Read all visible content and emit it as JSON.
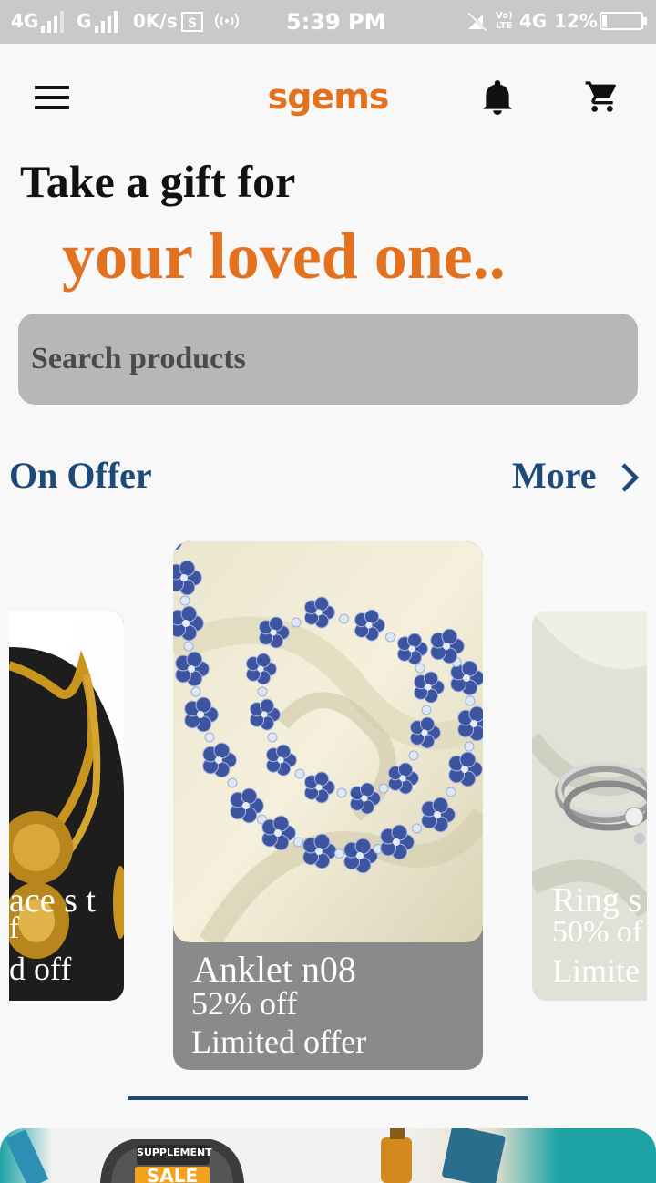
{
  "status_bar": {
    "network_1": "4G",
    "network_2": "G",
    "speed": "0K/s",
    "time": "5:39 PM",
    "volte": "Vo) LTE",
    "network_3": "4G",
    "battery": "12%"
  },
  "app_bar": {
    "logo_part1": "s",
    "logo_part2": "ge",
    "logo_part3": "ms",
    "icons": [
      "menu-icon",
      "bell-icon",
      "cart-icon"
    ]
  },
  "hero": {
    "line1": "Take a gift for",
    "line2": "your loved one.."
  },
  "search": {
    "placeholder": "Search products"
  },
  "offers": {
    "title": "On Offer",
    "more_label": "More",
    "cards": [
      {
        "name_partial": "ace s t",
        "line2_partial": "f",
        "line3_partial": "d off"
      },
      {
        "name": "Anklet n08",
        "discount": "52% off",
        "tag": "Limited offer"
      },
      {
        "name_partial": "Ring s",
        "discount_partial": "50% of",
        "tag_partial": "Limite"
      }
    ]
  },
  "banner": {
    "badge_top": "SUPPLEMENT",
    "badge_main": "SALE"
  },
  "colors": {
    "accent_orange": "#e27220",
    "navy": "#1d4a78",
    "status_bar": "#c9c9c9",
    "search_bg": "#b7b7b7",
    "caption_bg": "#8a8a8a"
  }
}
